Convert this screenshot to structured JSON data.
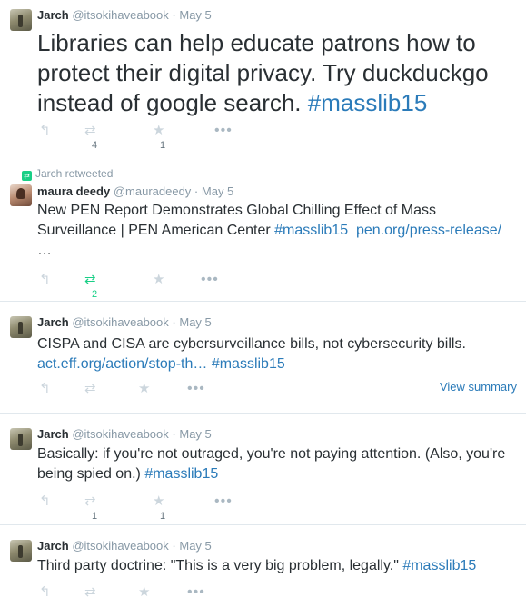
{
  "icons": {
    "reply": "reply-icon",
    "retweet": "retweet-icon",
    "favorite": "star-icon",
    "more": "more-icon"
  },
  "colors": {
    "link": "#2b7bb9",
    "retweet_active": "#19cf86",
    "muted": "#8899a6"
  },
  "tweets": [
    {
      "name": "Jarch",
      "handle": "@itsokihaveabook",
      "dot": "·",
      "time": "May 5",
      "text_before": "Libraries can help educate patrons how to protect their digital privacy. Try duckduckgo instead of google search. ",
      "hashtag": "#masslib15",
      "retweets": "4",
      "favorites": "1"
    },
    {
      "context": "Jarch retweeted",
      "name": "maura deedy",
      "handle": "@mauradeedy",
      "dot": "·",
      "time": "May 5",
      "text_before": "New PEN Report Demonstrates Global Chilling Effect of Mass Surveillance | PEN American Center ",
      "hashtag": "#masslib15",
      "link": "pen.org/press-release/",
      "ellipsis": "…",
      "retweets": "2"
    },
    {
      "name": "Jarch",
      "handle": "@itsokihaveabook",
      "dot": "·",
      "time": "May 5",
      "text_before": "CISPA and CISA are cybersurveillance bills, not cybersecurity bills. ",
      "link": "act.eff.org/action/stop-th…",
      "hashtag": "#masslib15",
      "view_summary": "View summary"
    },
    {
      "name": "Jarch",
      "handle": "@itsokihaveabook",
      "dot": "·",
      "time": "May 5",
      "text_before": "Basically: if you're not outraged, you're not paying attention. (Also, you're being spied on.) ",
      "hashtag": "#masslib15",
      "retweets": "1",
      "favorites": "1"
    },
    {
      "name": "Jarch",
      "handle": "@itsokihaveabook",
      "dot": "·",
      "time": "May 5",
      "text_before": "Third party doctrine: \"This is a very big problem, legally.\" ",
      "hashtag": "#masslib15"
    }
  ]
}
